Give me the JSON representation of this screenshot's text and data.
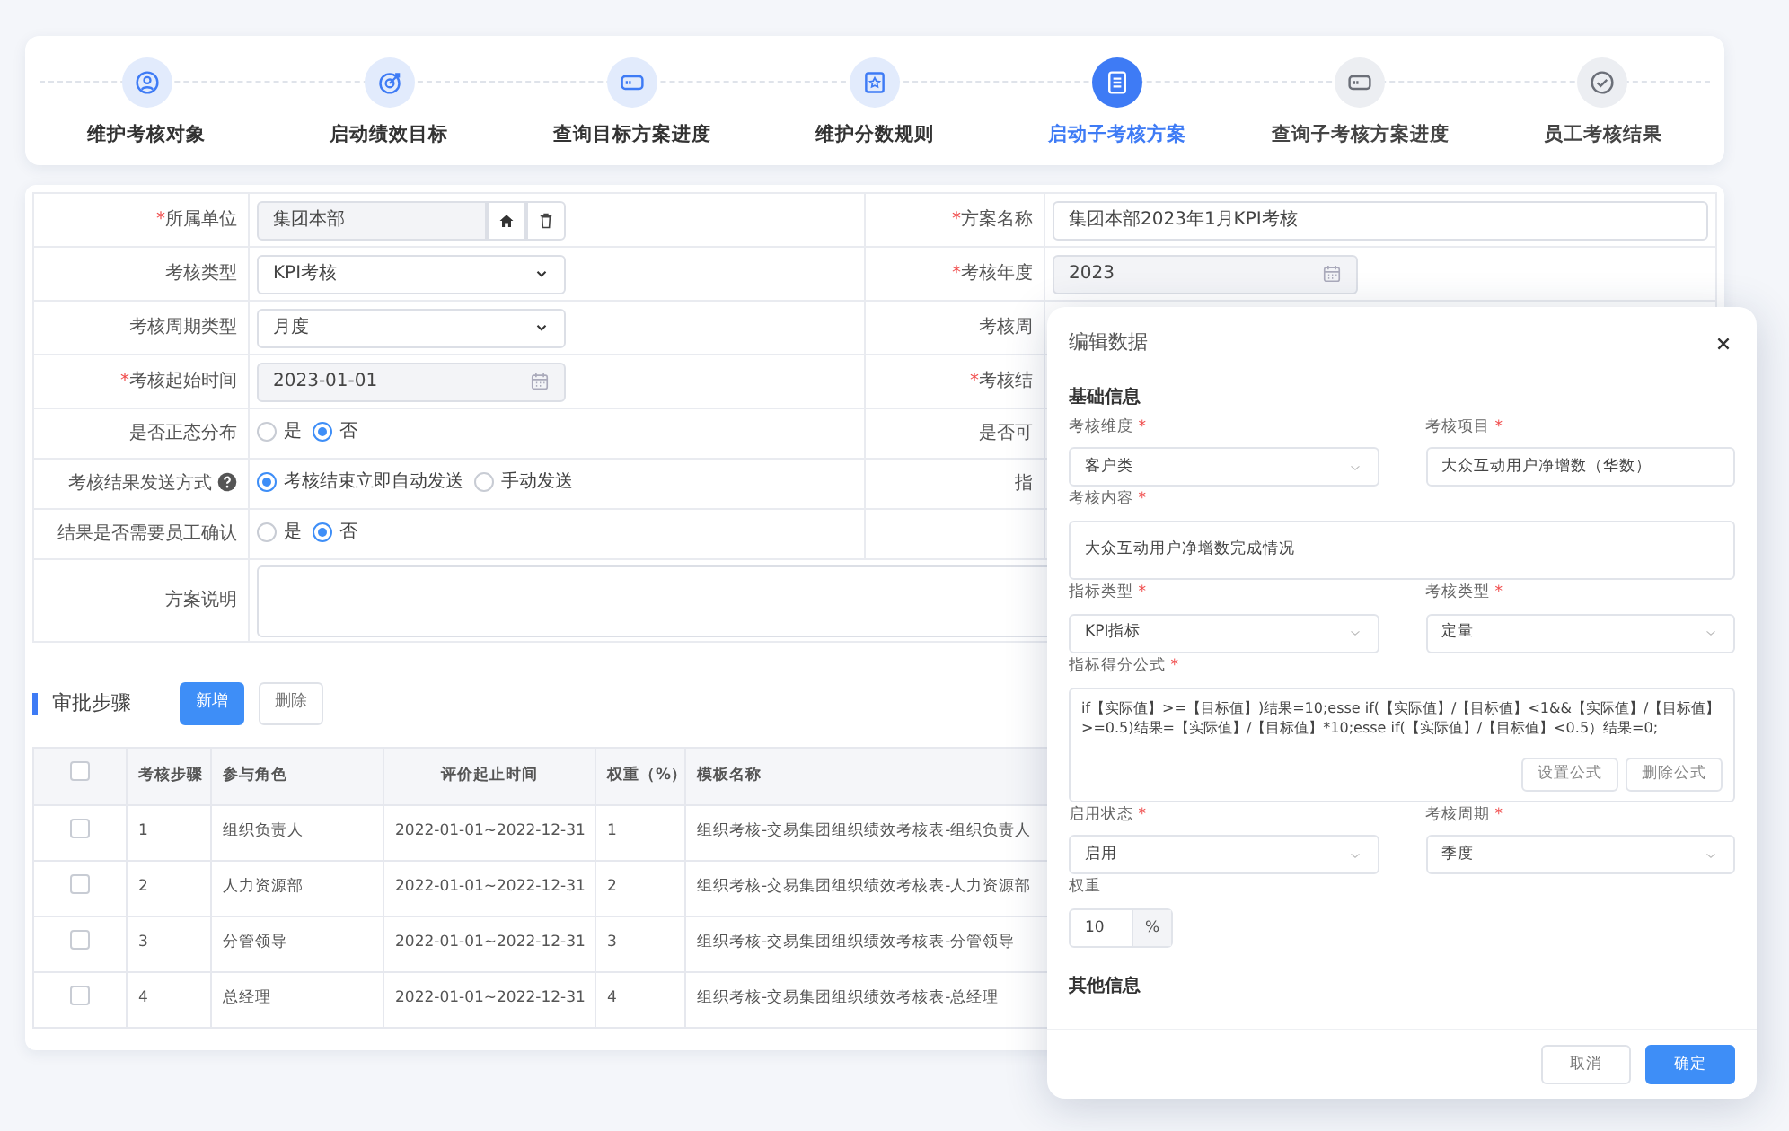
{
  "steps": [
    {
      "label": "维护考核对象",
      "completed": true,
      "active": false
    },
    {
      "label": "启动绩效目标",
      "completed": true,
      "active": false
    },
    {
      "label": "查询目标方案进度",
      "completed": true,
      "active": false
    },
    {
      "label": "维护分数规则",
      "completed": true,
      "active": false
    },
    {
      "label": "启动子考核方案",
      "active": true
    },
    {
      "label": "查询子考核方案进度",
      "completed": false,
      "active": false
    },
    {
      "label": "员工考核结果",
      "completed": false,
      "active": false
    }
  ],
  "form": {
    "rows": [
      {
        "left": {
          "required_mark": "*",
          "label": "所属单位",
          "kind": "picker",
          "value": "集团本部"
        },
        "right": {
          "required_mark": "*",
          "label": "方案名称",
          "kind": "text",
          "value": "集团本部2023年1月KPI考核"
        }
      },
      {
        "left": {
          "label": "考核类型",
          "kind": "select",
          "value": "KPI考核"
        },
        "right": {
          "required_mark": "*",
          "label": "考核年度",
          "kind": "date",
          "value": "2023"
        }
      },
      {
        "left": {
          "label": "考核周期类型",
          "kind": "select",
          "value": "月度"
        },
        "right": {
          "label": "考核周",
          "kind": "none"
        }
      },
      {
        "left": {
          "required_mark": "*",
          "label": "考核起始时间",
          "kind": "date",
          "value": "2023-01-01"
        },
        "right": {
          "required_mark": "*",
          "label": "考核结",
          "kind": "none"
        }
      },
      {
        "left": {
          "label": "是否正态分布",
          "kind": "radio",
          "options": [
            {
              "label": "是",
              "selected": false
            },
            {
              "label": "否",
              "selected": true
            }
          ]
        },
        "right": {
          "label": "是否可",
          "kind": "none"
        }
      },
      {
        "left": {
          "label": "考核结果发送方式",
          "help": true,
          "kind": "radio",
          "options": [
            {
              "label": "考核结束立即自动发送",
              "selected": true
            },
            {
              "label": "手动发送",
              "selected": false
            }
          ]
        },
        "right": {
          "label": "指",
          "kind": "none"
        }
      },
      {
        "left": {
          "label": "结果是否需要员工确认",
          "kind": "radio",
          "options": [
            {
              "label": "是",
              "selected": false
            },
            {
              "label": "否",
              "selected": true
            }
          ]
        }
      },
      {
        "left": {
          "label": "方案说明",
          "kind": "textarea"
        }
      }
    ]
  },
  "approval": {
    "title": "审批步骤",
    "buttons": [
      {
        "label": "新增",
        "kind": "primary"
      },
      {
        "label": "删除",
        "kind": "secondary"
      }
    ],
    "header_checked": false,
    "columns": [
      "考核步骤",
      "参与角色",
      "评价起止时间",
      "权重（%）",
      "模板名称"
    ],
    "rows": [
      {
        "checked": false,
        "cells": [
          "1",
          "组织负责人",
          "2022-01-01~2022-12-31",
          "1",
          "组织考核-交易集团组织绩效考核表-组织负责人"
        ]
      },
      {
        "checked": false,
        "cells": [
          "2",
          "人力资源部",
          "2022-01-01~2022-12-31",
          "2",
          "组织考核-交易集团组织绩效考核表-人力资源部"
        ]
      },
      {
        "checked": false,
        "cells": [
          "3",
          "分管领导",
          "2022-01-01~2022-12-31",
          "3",
          "组织考核-交易集团组织绩效考核表-分管领导"
        ]
      },
      {
        "checked": false,
        "cells": [
          "4",
          "总经理",
          "2022-01-01~2022-12-31",
          "4",
          "组织考核-交易集团组织绩效考核表-总经理"
        ]
      }
    ]
  },
  "modal": {
    "title": "编辑数据",
    "sections": [
      {
        "title": "基础信息",
        "fields": [
          {
            "label": "考核维度",
            "required_mark": "*",
            "kind": "select",
            "value": "客户类"
          },
          {
            "label": "考核项目",
            "required_mark": "*",
            "kind": "text",
            "value": "大众互动用户净增数（华数）"
          },
          {
            "label": "考核内容",
            "required_mark": "*",
            "kind": "textarea",
            "value": "大众互动用户净增数完成情况"
          },
          {
            "label": "指标类型",
            "required_mark": "*",
            "kind": "select",
            "value": "KPI指标"
          },
          {
            "label": "考核类型",
            "required_mark": "*",
            "kind": "select",
            "value": "定量"
          },
          {
            "label": "指标得分公式",
            "required_mark": "*",
            "kind": "formula",
            "value": "if【实际值】>=【目标值】)结果=10;esse if(【实际值】/【目标值】<1&&【实际值】/【目标值】>=0.5)结果=【实际值】/【目标值】*10;esse if(【实际值】/【目标值】<0.5）结果=0;",
            "buttons": [
              "设置公式",
              "删除公式"
            ]
          },
          {
            "label": "启用状态",
            "required_mark": "*",
            "kind": "select",
            "value": "启用"
          },
          {
            "label": "考核周期",
            "required_mark": "*",
            "kind": "select",
            "value": "季度"
          },
          {
            "label": "权重",
            "kind": "suffix",
            "value": "10",
            "suffix": "%"
          }
        ]
      },
      {
        "title": "其他信息"
      }
    ],
    "buttons": [
      {
        "label": "取消",
        "kind": "secondary"
      },
      {
        "label": "确定",
        "kind": "primary"
      }
    ]
  }
}
